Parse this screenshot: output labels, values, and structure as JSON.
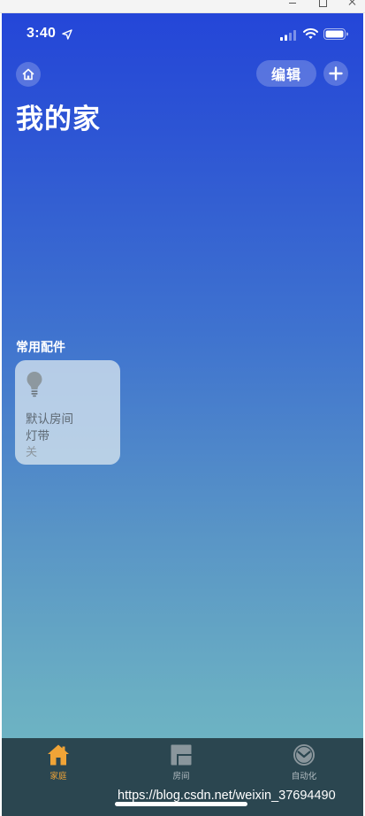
{
  "window": {
    "minimize_icon": "minimize-icon",
    "maximize_icon": "maximize-icon",
    "close_icon": "close-icon"
  },
  "status_bar": {
    "time": "3:40",
    "icons": [
      "location-arrow-icon",
      "cellular-signal-icon",
      "wifi-icon",
      "battery-icon"
    ]
  },
  "header": {
    "home_icon": "home-icon",
    "edit_label": "编辑",
    "add_icon": "plus-icon",
    "title": "我的家"
  },
  "section": {
    "title": "常用配件"
  },
  "accessory": {
    "icon": "lightbulb-icon",
    "room": "默认房间",
    "name": "灯带",
    "status": "关"
  },
  "tab_bar": {
    "tabs": [
      {
        "label": "家庭",
        "icon": "home-tab-icon",
        "selected": true
      },
      {
        "label": "房间",
        "icon": "rooms-tab-icon",
        "selected": false
      },
      {
        "label": "自动化",
        "icon": "automation-clock-icon",
        "selected": false
      }
    ]
  },
  "watermark": "https://blog.csdn.net/weixin_37694490",
  "colors": {
    "accent": "#f0a437",
    "gradient_top": "#2446d8",
    "gradient_bottom": "#72bcc4",
    "tab_bar_bg": "#2b4650"
  }
}
